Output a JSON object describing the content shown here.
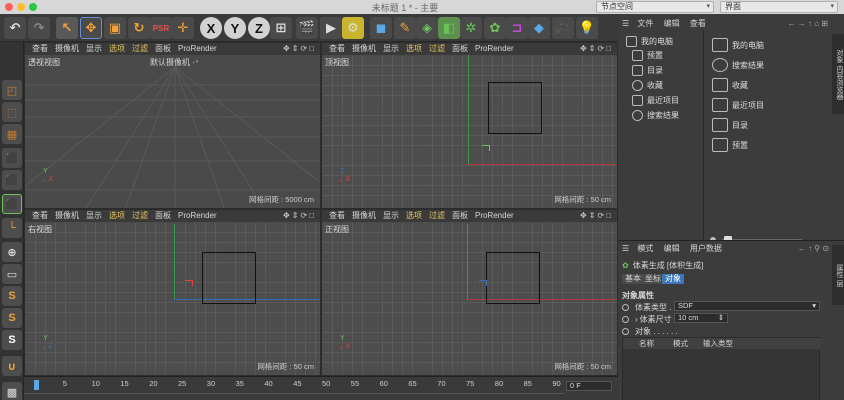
{
  "window": {
    "title": "未标题 1 * - 主要",
    "dropdown_left": "节点空间",
    "dropdown_right": "界面"
  },
  "viewports": {
    "menu": [
      "查看",
      "摄像机",
      "显示",
      "选项",
      "过滤",
      "面板",
      "ProRender"
    ],
    "perspective": {
      "name": "透视视图",
      "camera": "默认摄像机 ·⁺",
      "grid": "网格间距 : 5000 cm"
    },
    "top": {
      "name": "顶视图",
      "grid": "网格间距 : 50 cm"
    },
    "right": {
      "name": "右视图",
      "grid": "网格间距 : 50 cm"
    },
    "front": {
      "name": "正视图",
      "grid": "网格间距 : 50 cm"
    }
  },
  "objects_panel": {
    "menu": [
      "文件",
      "编辑",
      "查看"
    ],
    "tree": [
      "我的电脑",
      "预置",
      "目录",
      "收藏",
      "最近项目",
      "搜索结果"
    ],
    "content": [
      "我的电脑",
      "搜索结果",
      "收藏",
      "最近项目",
      "目录",
      "预置"
    ]
  },
  "attributes": {
    "menu": [
      "模式",
      "编辑",
      "用户数据"
    ],
    "object_title": "体素生成 [体积生成]",
    "tabs": [
      "基本",
      "坐标",
      "对象"
    ],
    "section": "对象属性",
    "voxel_type_label": "体素类型 . . . .",
    "voxel_type_value": "SDF",
    "voxel_size_label": "体素尺寸",
    "voxel_size_value": "10 cm",
    "objects_label": "对象 . . . . . .",
    "columns": [
      "名称",
      "模式",
      "输入类型"
    ]
  },
  "timeline": {
    "ticks": [
      "0",
      "5",
      "10",
      "15",
      "20",
      "25",
      "30",
      "35",
      "40",
      "45",
      "50",
      "55",
      "60",
      "65",
      "70",
      "75",
      "80",
      "85",
      "90"
    ],
    "frame": "0 F"
  }
}
